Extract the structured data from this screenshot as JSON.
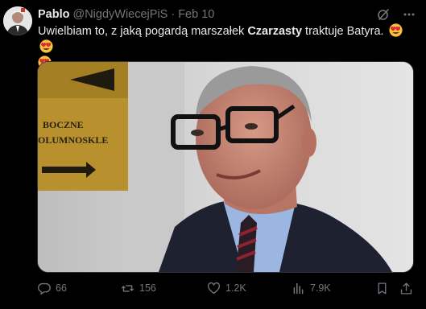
{
  "user": {
    "display_name": "Pablo",
    "handle": "@NigdyWiecejPiS",
    "separator": "·",
    "date": "Feb 10"
  },
  "tweet": {
    "text_before": "Uwielbiam to, z jaką pogardą marszałek ",
    "text_bold": "Czarzasty",
    "text_after": " traktuje Batyra."
  },
  "image_sign": {
    "line1": "BOCZNE",
    "line2": "OLUMNOSKLE"
  },
  "actions": {
    "replies": "66",
    "reposts": "156",
    "likes": "1.2K",
    "views": "7.9K"
  },
  "colors": {
    "background": "#000000",
    "text": "#e7e9ea",
    "muted": "#71767b",
    "border": "#2f3336"
  }
}
